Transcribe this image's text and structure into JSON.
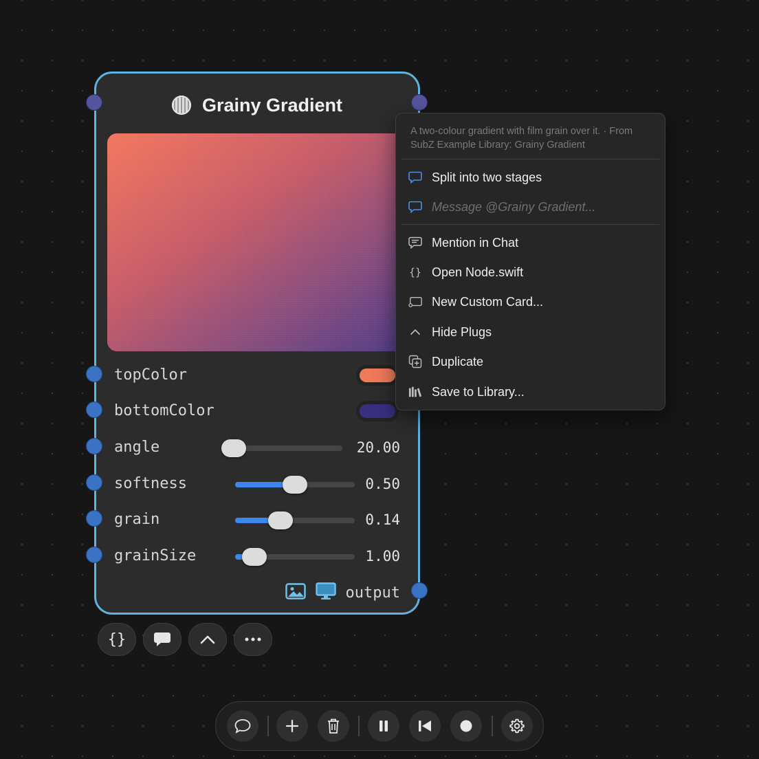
{
  "node": {
    "title": "Grainy Gradient",
    "title_icon": "film-grain-icon",
    "params": [
      {
        "name": "topColor",
        "type": "color",
        "color": "#f07a5a"
      },
      {
        "name": "bottomColor",
        "type": "color",
        "color": "#3a2f7e"
      },
      {
        "name": "angle",
        "type": "slider",
        "value": "20.00",
        "fraction": 0.05
      },
      {
        "name": "softness",
        "type": "slider",
        "value": "0.50",
        "fraction": 0.5
      },
      {
        "name": "grain",
        "type": "slider",
        "value": "0.14",
        "fraction": 0.38
      },
      {
        "name": "grainSize",
        "type": "slider",
        "value": "1.00",
        "fraction": 0.16
      }
    ],
    "output": {
      "label": "output",
      "icons": [
        "image-icon",
        "monitor-icon"
      ]
    },
    "gradient_colors": [
      "#f2755c",
      "#4c3a86"
    ],
    "accent_color": "#5fb3e0"
  },
  "node_actions": [
    {
      "name": "code-braces-icon",
      "glyph": "{}"
    },
    {
      "name": "chat-bubble-icon"
    },
    {
      "name": "chevron-up-icon"
    },
    {
      "name": "more-horizontal-icon"
    }
  ],
  "context_menu": {
    "description": "A two-colour gradient with film grain over it. · From SubZ Example Library: Grainy Gradient",
    "items": [
      {
        "label": "Split into two stages",
        "icon": "chat-bubble-icon"
      },
      {
        "label": "Message @Grainy Gradient...",
        "icon": "chat-bubble-icon",
        "placeholder": true
      },
      {
        "label": "Mention in Chat",
        "icon": "chat-lines-icon"
      },
      {
        "label": "Open Node.swift",
        "icon": "code-braces-icon"
      },
      {
        "label": "New Custom Card...",
        "icon": "card-icon"
      },
      {
        "label": "Hide Plugs",
        "icon": "chevron-up-icon"
      },
      {
        "label": "Duplicate",
        "icon": "duplicate-icon"
      },
      {
        "label": "Save to Library...",
        "icon": "library-icon"
      }
    ]
  },
  "toolbar": {
    "buttons": [
      "chat-bubble-icon",
      "plus-icon",
      "trash-icon",
      "pause-icon",
      "skip-back-icon",
      "record-icon",
      "gear-icon"
    ]
  }
}
